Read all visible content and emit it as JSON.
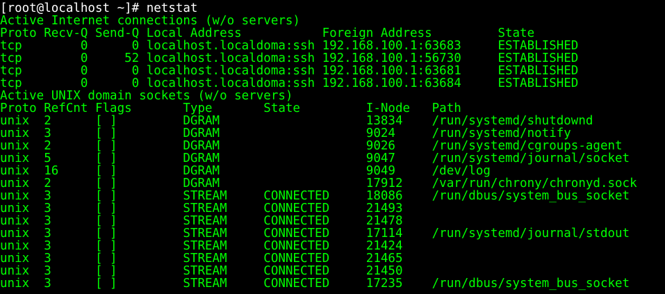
{
  "terminal": {
    "prompt": "[root@localhost ~]# ",
    "command": "netstat",
    "lines": [
      "Active Internet connections (w/o servers)",
      "Proto Recv-Q Send-Q Local Address           Foreign Address         State",
      "tcp        0      0 localhost.localdoma:ssh 192.168.100.1:63683     ESTABLISHED",
      "tcp        0     52 localhost.localdoma:ssh 192.168.100.1:56730     ESTABLISHED",
      "tcp        0      0 localhost.localdoma:ssh 192.168.100.1:63681     ESTABLISHED",
      "tcp        0      0 localhost.localdoma:ssh 192.168.100.1:63684     ESTABLISHED",
      "Active UNIX domain sockets (w/o servers)",
      "Proto RefCnt Flags       Type       State         I-Node   Path",
      "unix  2      [ ]         DGRAM                    13834    /run/systemd/shutdownd",
      "unix  3      [ ]         DGRAM                    9024     /run/systemd/notify",
      "unix  2      [ ]         DGRAM                    9026     /run/systemd/cgroups-agent",
      "unix  5      [ ]         DGRAM                    9047     /run/systemd/journal/socket",
      "unix  16     [ ]         DGRAM                    9049     /dev/log",
      "unix  2      [ ]         DGRAM                    17912    /var/run/chrony/chronyd.sock",
      "unix  3      [ ]         STREAM     CONNECTED     18086    /run/dbus/system_bus_socket",
      "unix  3      [ ]         STREAM     CONNECTED     21493    ",
      "unix  3      [ ]         STREAM     CONNECTED     21478    ",
      "unix  3      [ ]         STREAM     CONNECTED     17114    /run/systemd/journal/stdout",
      "unix  3      [ ]         STREAM     CONNECTED     21424    ",
      "unix  3      [ ]         STREAM     CONNECTED     21465    ",
      "unix  3      [ ]         STREAM     CONNECTED     21450    ",
      "unix  3      [ ]         STREAM     CONNECTED     17235    /run/dbus/system_bus_socket"
    ]
  },
  "colors": {
    "background": "#000000",
    "output_text": "#00ff00",
    "prompt_text": "#ffffff"
  }
}
